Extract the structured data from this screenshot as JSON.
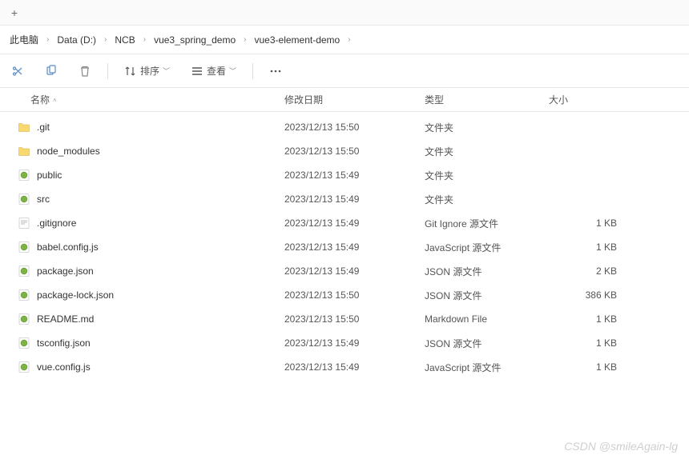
{
  "tab_bar": {
    "plus": "+"
  },
  "breadcrumb": [
    {
      "label": "此电脑"
    },
    {
      "label": "Data (D:)"
    },
    {
      "label": "NCB"
    },
    {
      "label": "vue3_spring_demo"
    },
    {
      "label": "vue3-element-demo"
    }
  ],
  "toolbar": {
    "sort_label": "排序",
    "view_label": "查看"
  },
  "columns": {
    "name": "名称",
    "date": "修改日期",
    "type": "类型",
    "size": "大小"
  },
  "files": [
    {
      "icon": "folder",
      "name": ".git",
      "date": "2023/12/13 15:50",
      "type": "文件夹",
      "size": ""
    },
    {
      "icon": "folder",
      "name": "node_modules",
      "date": "2023/12/13 15:50",
      "type": "文件夹",
      "size": ""
    },
    {
      "icon": "js",
      "name": "public",
      "date": "2023/12/13 15:49",
      "type": "文件夹",
      "size": ""
    },
    {
      "icon": "js",
      "name": "src",
      "date": "2023/12/13 15:49",
      "type": "文件夹",
      "size": ""
    },
    {
      "icon": "file",
      "name": ".gitignore",
      "date": "2023/12/13 15:49",
      "type": "Git Ignore 源文件",
      "size": "1 KB"
    },
    {
      "icon": "js",
      "name": "babel.config.js",
      "date": "2023/12/13 15:49",
      "type": "JavaScript 源文件",
      "size": "1 KB"
    },
    {
      "icon": "js",
      "name": "package.json",
      "date": "2023/12/13 15:49",
      "type": "JSON 源文件",
      "size": "2 KB"
    },
    {
      "icon": "js",
      "name": "package-lock.json",
      "date": "2023/12/13 15:50",
      "type": "JSON 源文件",
      "size": "386 KB"
    },
    {
      "icon": "js",
      "name": "README.md",
      "date": "2023/12/13 15:50",
      "type": "Markdown File",
      "size": "1 KB"
    },
    {
      "icon": "js",
      "name": "tsconfig.json",
      "date": "2023/12/13 15:49",
      "type": "JSON 源文件",
      "size": "1 KB"
    },
    {
      "icon": "js",
      "name": "vue.config.js",
      "date": "2023/12/13 15:49",
      "type": "JavaScript 源文件",
      "size": "1 KB"
    }
  ],
  "watermark": "CSDN @smileAgain-lg"
}
